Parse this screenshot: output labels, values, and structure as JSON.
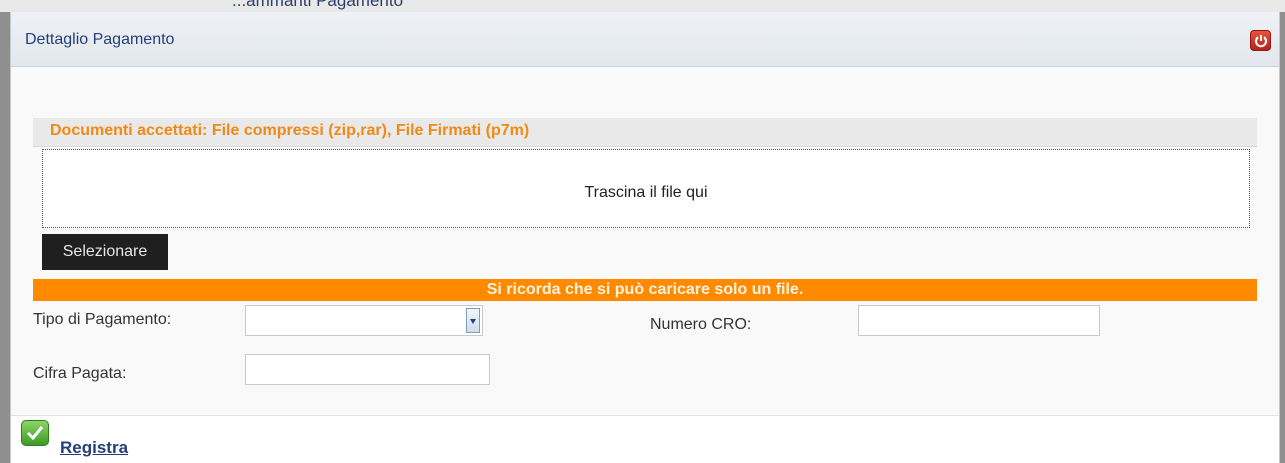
{
  "background": {
    "partial_title": "...ammanti Pagamento"
  },
  "dialog": {
    "title": "Dettaglio Pagamento",
    "close_icon": "power-icon",
    "upload": {
      "accepted_text": "Documenti accettati: File compressi (zip,rar), File Firmati (p7m)",
      "dropzone_text": "Trascina il file qui",
      "select_button": "Selezionare",
      "notice": "Si ricorda che si può caricare solo un file."
    },
    "form": {
      "tipo_label": "Tipo di Pagamento:",
      "tipo_value": "",
      "cro_label": "Numero CRO:",
      "cro_value": "",
      "cifra_label": "Cifra Pagata:",
      "cifra_value": ""
    },
    "footer": {
      "register_label": "Registra",
      "register_icon": "check-icon"
    }
  },
  "colors": {
    "accent_orange": "#ff8a00",
    "title_blue": "#24407a",
    "close_red": "#c62d1f",
    "check_green": "#4caf2f"
  }
}
